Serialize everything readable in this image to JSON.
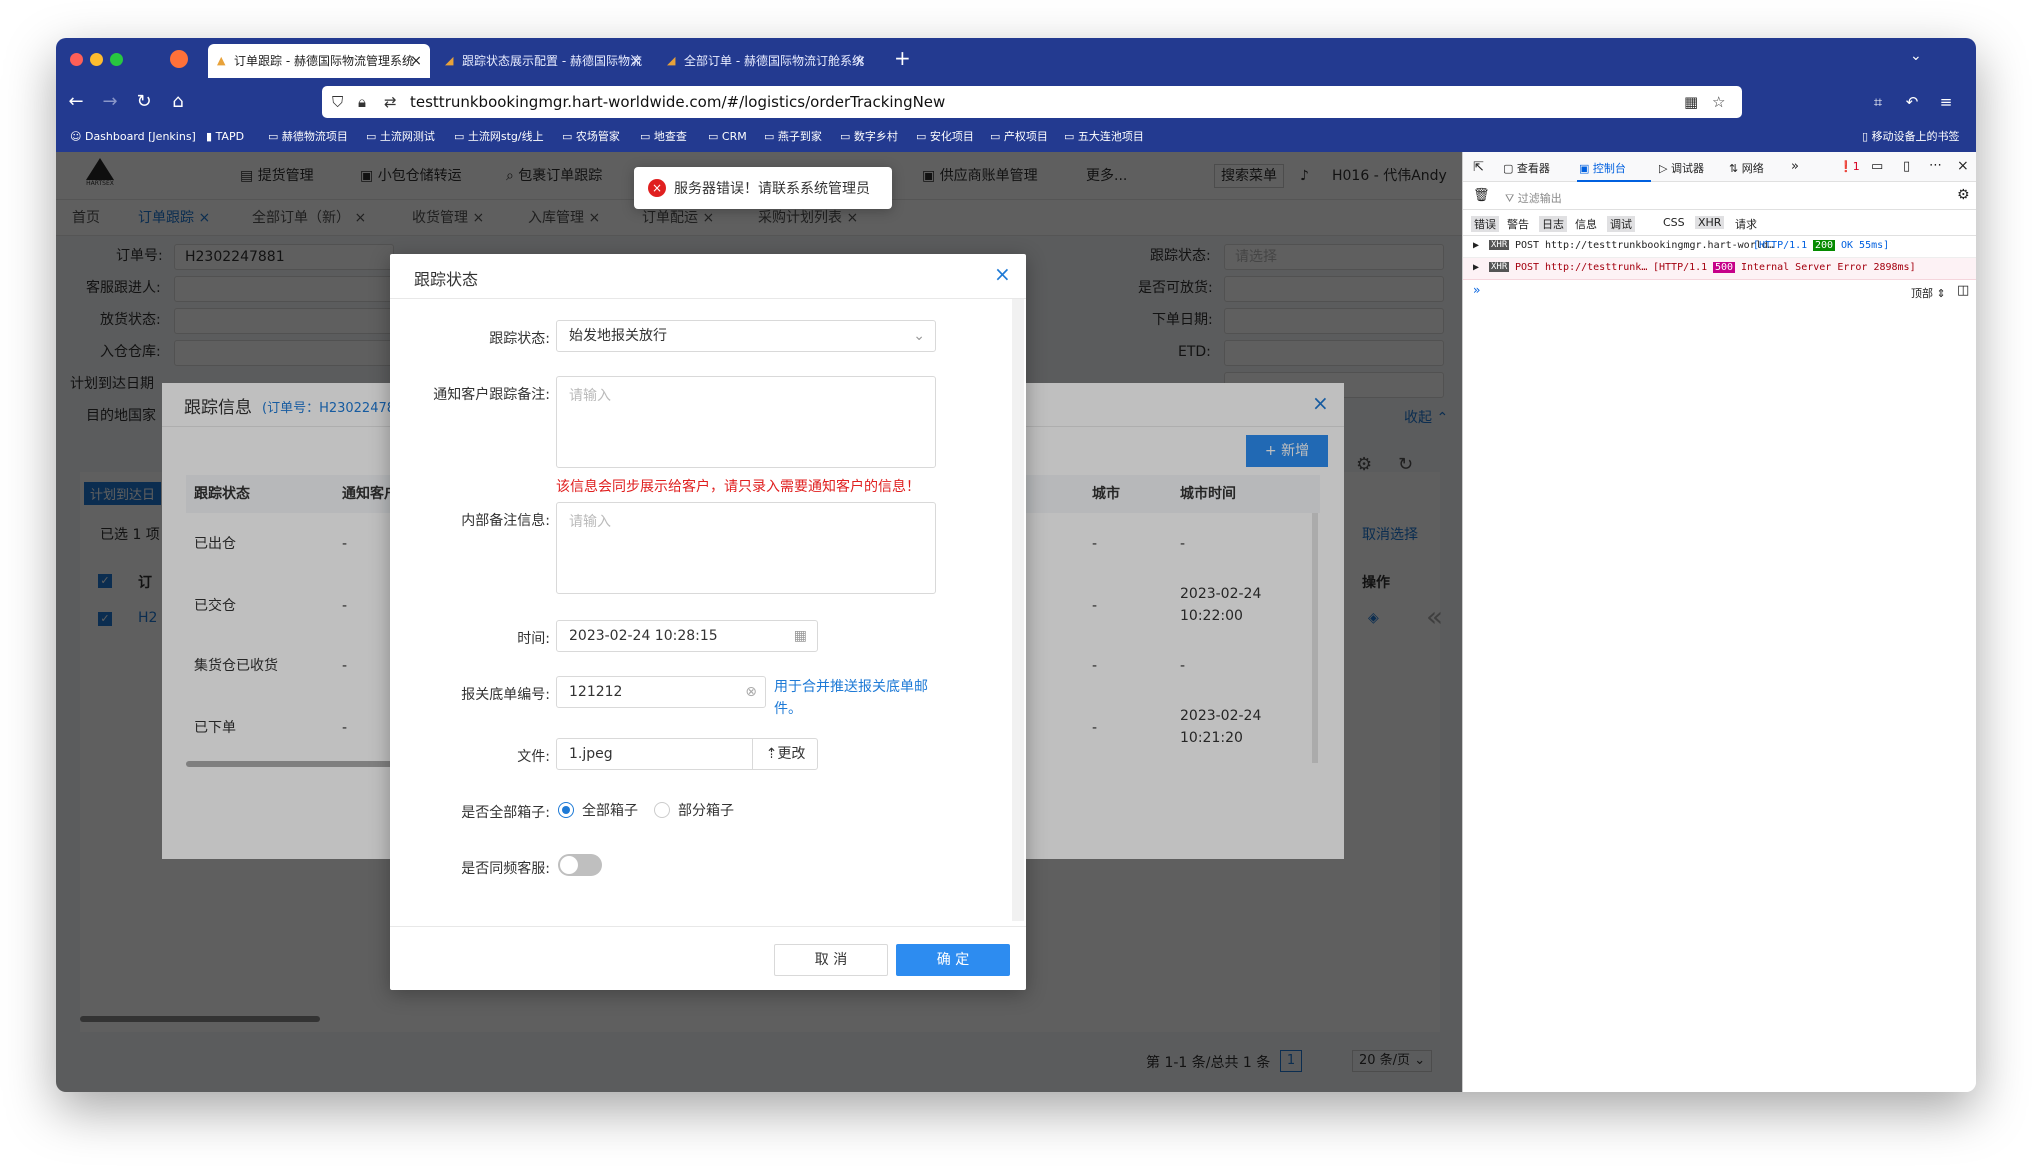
{
  "browser": {
    "tabs": [
      {
        "label": "订单跟踪 - 赫德国际物流管理系统"
      },
      {
        "label": "跟踪状态展示配置 - 赫德国际物流"
      },
      {
        "label": "全部订单 - 赫德国际物流订舱系统"
      }
    ],
    "url": "testtrunkbookingmgr.hart-worldwide.com/#/logistics/orderTrackingNew",
    "bookmarks": [
      "Dashboard [Jenkins]",
      "TAPD",
      "赫德物流项目",
      "土流网测试",
      "土流网stg/线上",
      "农场管家",
      "地查查",
      "CRM",
      "燕子到家",
      "数字乡村",
      "安化项目",
      "产权项目",
      "五大连池项目"
    ],
    "mobile_bookmarks": "移动设备上的书签"
  },
  "app": {
    "logo_text": "HARTSEX",
    "menu": [
      "提货管理",
      "小包仓储转运",
      "包裹订单跟踪",
      "供应商账单管理",
      "更多..."
    ],
    "search_menu": "搜索菜单",
    "user": "H016 - 代伟Andy",
    "page_tabs": [
      "首页",
      "订单跟踪",
      "全部订单（新）",
      "收货管理",
      "入库管理",
      "订单配运",
      "采购计划列表"
    ],
    "filters": {
      "order_no_label": "订单号:",
      "order_no_value": "H2302247881",
      "cs_label": "客服跟进人:",
      "release_label": "放货状态:",
      "warehouse_label": "入仓仓库:",
      "plan_arrival_label": "计划到达日期",
      "dest_country_label": "目的地国家",
      "track_status_label": "跟踪状态:",
      "track_status_ph": "请选择",
      "can_release_label": "是否可放货:",
      "order_date_label": "下单日期:",
      "etd_label": "ETD:",
      "collapse": "收起"
    },
    "plan_arrival_btn": "计划到达日",
    "selected_text": "已选 1 项",
    "cancel_select": "取消选择",
    "op_header": "操作",
    "order_col_short": "订",
    "row_order_short": "H2",
    "pagination": {
      "summary": "第 1-1 条/总共 1 条",
      "page": "1",
      "page_size": "20 条/页"
    }
  },
  "track_panel": {
    "title": "跟踪信息",
    "order_ref": "(订单号：H2302247881)",
    "add_button": "新增",
    "columns": [
      "跟踪状态",
      "通知客户跟踪备",
      "城市",
      "城市时间"
    ],
    "rows": [
      {
        "status": "已出仓",
        "note": "-",
        "city": "-",
        "city_time": "-"
      },
      {
        "status": "已交仓",
        "note": "-",
        "city": "-",
        "city_time": "2023-02-24 10:22:00"
      },
      {
        "status": "集货仓已收货",
        "note": "-",
        "city": "-",
        "city_time": "-"
      },
      {
        "status": "已下单",
        "note": "-",
        "city": "-",
        "city_time": "2023-02-24 10:21:20"
      }
    ]
  },
  "toast": {
    "message": "服务器错误！请联系系统管理员"
  },
  "modal": {
    "title": "跟踪状态",
    "status_label": "跟踪状态:",
    "status_value": "始发地报关放行",
    "notify_label": "通知客户跟踪备注:",
    "notify_ph": "请输入",
    "notify_warning": "该信息会同步展示给客户，请只录入需要通知客户的信息！",
    "internal_label": "内部备注信息:",
    "internal_ph": "请输入",
    "time_label": "时间:",
    "time_value": "2023-02-24 10:28:15",
    "customs_label": "报关底单编号:",
    "customs_value": "121212",
    "customs_hint": "用于合并推送报关底单邮件。",
    "file_label": "文件:",
    "file_value": "1.jpeg",
    "file_change": "更改",
    "all_box_label": "是否全部箱子:",
    "all_box_opt1": "全部箱子",
    "all_box_opt2": "部分箱子",
    "sync_cs_label": "是否同频客服:",
    "cancel": "取 消",
    "confirm": "确 定"
  },
  "devtools": {
    "tabs": [
      "查看器",
      "控制台",
      "调试器",
      "网络"
    ],
    "error_count": "1",
    "filter_ph": "过滤输出",
    "levels": [
      "错误",
      "警告",
      "日志",
      "信息",
      "调试"
    ],
    "extra": [
      "CSS",
      "XHR",
      "请求"
    ],
    "requests": [
      {
        "tag": "XHR",
        "method": "POST",
        "url": "http://testtrunkbookingmgr.hart-world…",
        "proto": "[HTTP/1.1",
        "code": "200",
        "text": "OK 55ms]"
      },
      {
        "tag": "XHR",
        "method": "POST",
        "url": "http://testtrunk…",
        "proto": "[HTTP/1.1",
        "code": "500",
        "text": "Internal Server Error 2898ms]"
      }
    ],
    "top_label": "顶部"
  },
  "colors": {
    "brand_blue": "#233a90",
    "link_blue": "#1e7ad6",
    "error_red": "#e02020",
    "primary_btn": "#2d8cf0"
  }
}
